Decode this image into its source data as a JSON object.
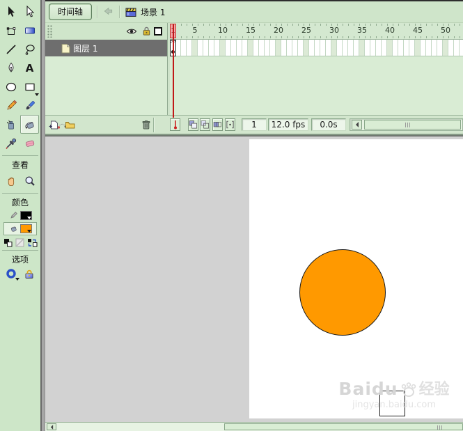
{
  "timeline": {
    "tab_label": "时间轴",
    "scene_label": "场景 1",
    "layer_name": "图层 1",
    "ruler_numbers": [
      "5",
      "10",
      "15",
      "20",
      "25",
      "30",
      "35",
      "40",
      "45",
      "50"
    ],
    "playhead_frame": "1",
    "status": {
      "current_frame": "1",
      "frame_rate": "12.0 fps",
      "elapsed_time": "0.0s"
    }
  },
  "toolbar": {
    "view_label": "查看",
    "colors_label": "颜色",
    "options_label": "选项",
    "stroke_color": "#000000",
    "fill_color": "#FF9900",
    "text_tool_glyph": "A"
  },
  "stage": {
    "coin_fill": "#FF9900",
    "coin_stroke": "#1a1a1a"
  },
  "watermark": {
    "brand": "Baidu",
    "brand_suffix": "经验",
    "url": "jingyan.baidu.com"
  }
}
